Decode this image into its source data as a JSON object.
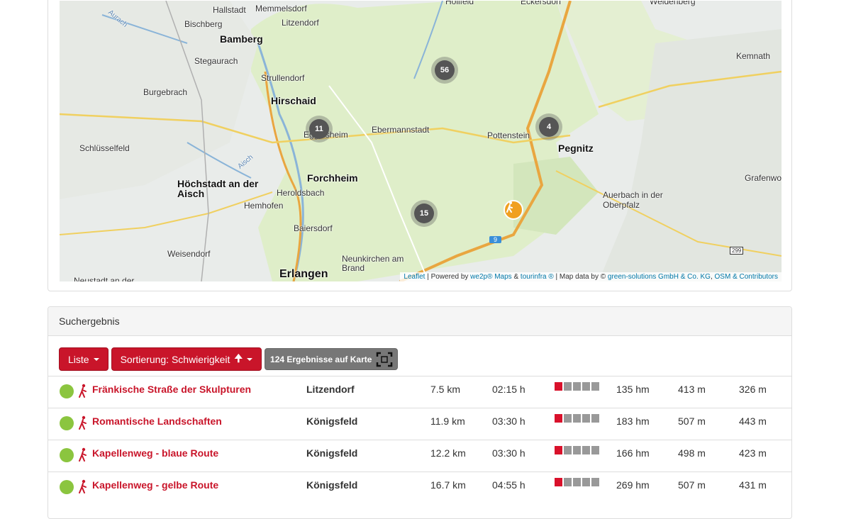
{
  "map": {
    "places": {
      "hallstadt": "Hallstadt",
      "memmelsdorf": "Memmelsdorf",
      "bischberg": "Bischberg",
      "bamberg": "Bamberg",
      "litzendorf": "Litzendorf",
      "stegaurach": "Stegaurach",
      "strullendorf": "Strullendorf",
      "burgebrach": "Burgebrach",
      "hirschaid": "Hirschaid",
      "eggolsheim": "Eggolsheim",
      "ebermannstadt": "Ebermannstadt",
      "pottenstein": "Pottenstein",
      "pegnitz": "Pegnitz",
      "kemnath": "Kemnath",
      "schluesselfeld": "Schlüsselfeld",
      "forchheim": "Forchheim",
      "hoechstadt": "Höchstadt an der Aisch",
      "heroldsbach": "Heroldsbach",
      "hemhofen": "Hemhofen",
      "baiersdorf": "Baiersdorf",
      "weisendorf": "Weisendorf",
      "neunkirchen": "Neunkirchen am Brand",
      "erlangen": "Erlangen",
      "auerbach": "Auerbach in der Oberpfalz",
      "grafenwoehr": "Grafenwo",
      "hollfeld": "Hollfeld",
      "weidenberg": "Weidenberg",
      "aurach": "Aurach",
      "aisch": "Aisch",
      "eckersdorf": "Eckersdorf",
      "neustadt": "Neustadt an der"
    },
    "clusters": {
      "c56": "56",
      "c11": "11",
      "c4": "4",
      "c15": "15"
    },
    "road_badges": {
      "b9": "9",
      "b299": "299"
    },
    "attribution": {
      "leaflet": "Leaflet",
      "powered": " | Powered by ",
      "we2p": "we2p® Maps",
      "amp": " & ",
      "tourinfra": "tourinfra ®",
      "mapdata": " | Map data by © ",
      "green": "green-solutions GmbH & Co. KG",
      "comma": ", ",
      "osm": "OSM & Contributors"
    }
  },
  "results": {
    "heading": "Suchergebnis",
    "list_button": "Liste",
    "sort_button": "Sortierung: Schwierigkeit",
    "map_button": "124 Ergebnisse auf Karte",
    "rows": [
      {
        "name": "Fränkische Straße der Skulpturen",
        "place": "Litzendorf",
        "distance": "7.5 km",
        "duration": "02:15 h",
        "difficulty": 1,
        "ascent": "135 hm",
        "max": "413 m",
        "min": "326 m"
      },
      {
        "name": "Romantische Landschaften",
        "place": "Königsfeld",
        "distance": "11.9 km",
        "duration": "03:30 h",
        "difficulty": 1,
        "ascent": "183 hm",
        "max": "507 m",
        "min": "443 m"
      },
      {
        "name": "Kapellenweg - blaue Route",
        "place": "Königsfeld",
        "distance": "12.2 km",
        "duration": "03:30 h",
        "difficulty": 1,
        "ascent": "166 hm",
        "max": "498 m",
        "min": "423 m"
      },
      {
        "name": "Kapellenweg - gelbe Route",
        "place": "Königsfeld",
        "distance": "16.7 km",
        "duration": "04:55 h",
        "difficulty": 1,
        "ascent": "269 hm",
        "max": "507 m",
        "min": "431 m"
      }
    ]
  },
  "colors": {
    "accent": "#c9152a",
    "status_ok": "#8bc53f",
    "cluster": "#555555",
    "pin": "#f0a020"
  }
}
